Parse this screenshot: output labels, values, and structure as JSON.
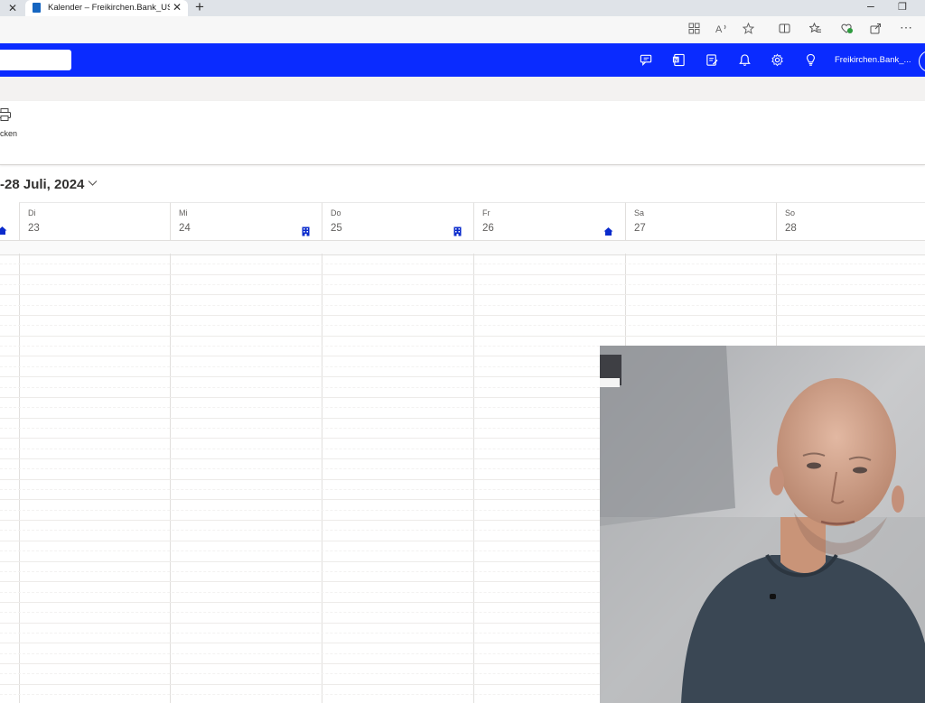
{
  "browser": {
    "prev_tab_close": "✕",
    "active_tab_title": "Kalender – Freikirchen.Bank_USER",
    "active_tab_close": "✕",
    "new_tab": "+",
    "minimize": "–",
    "restore": "❐"
  },
  "header": {
    "user_name": "Freikirchen.Bank_..."
  },
  "ribbon": {
    "print_label": "cken"
  },
  "calendar": {
    "date_range": "-28 Juli, 2024",
    "days": [
      {
        "name": "Di",
        "num": "23",
        "location": "none"
      },
      {
        "name": "Mi",
        "num": "24",
        "location": "office"
      },
      {
        "name": "Do",
        "num": "25",
        "location": "office"
      },
      {
        "name": "Fr",
        "num": "26",
        "location": "home"
      },
      {
        "name": "Sa",
        "num": "27",
        "location": "none"
      },
      {
        "name": "So",
        "num": "28",
        "location": "none"
      }
    ],
    "prev_day_location": "home"
  },
  "colors": {
    "header_bg": "#0a2bff",
    "location_icon": "#0a2bcc",
    "grid_line": "#e1dfdd"
  }
}
